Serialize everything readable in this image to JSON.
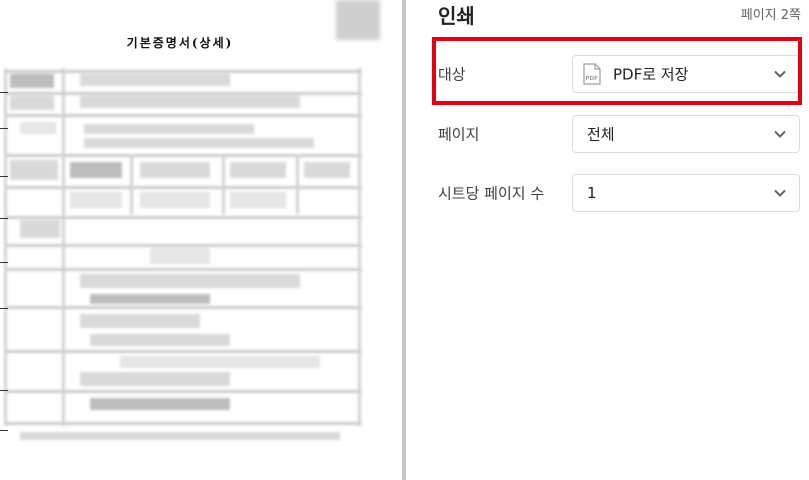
{
  "document": {
    "title": "기본증명서(상세)"
  },
  "print_panel": {
    "title": "인쇄",
    "page_count": "페이지 2쪽",
    "settings": [
      {
        "label": "대상",
        "value": "PDF로 저장",
        "icon": "pdf-icon",
        "highlighted": true
      },
      {
        "label": "페이지",
        "value": "전체"
      },
      {
        "label": "시트당 페이지 수",
        "value": "1"
      }
    ],
    "highlight_color": "#e60012"
  }
}
